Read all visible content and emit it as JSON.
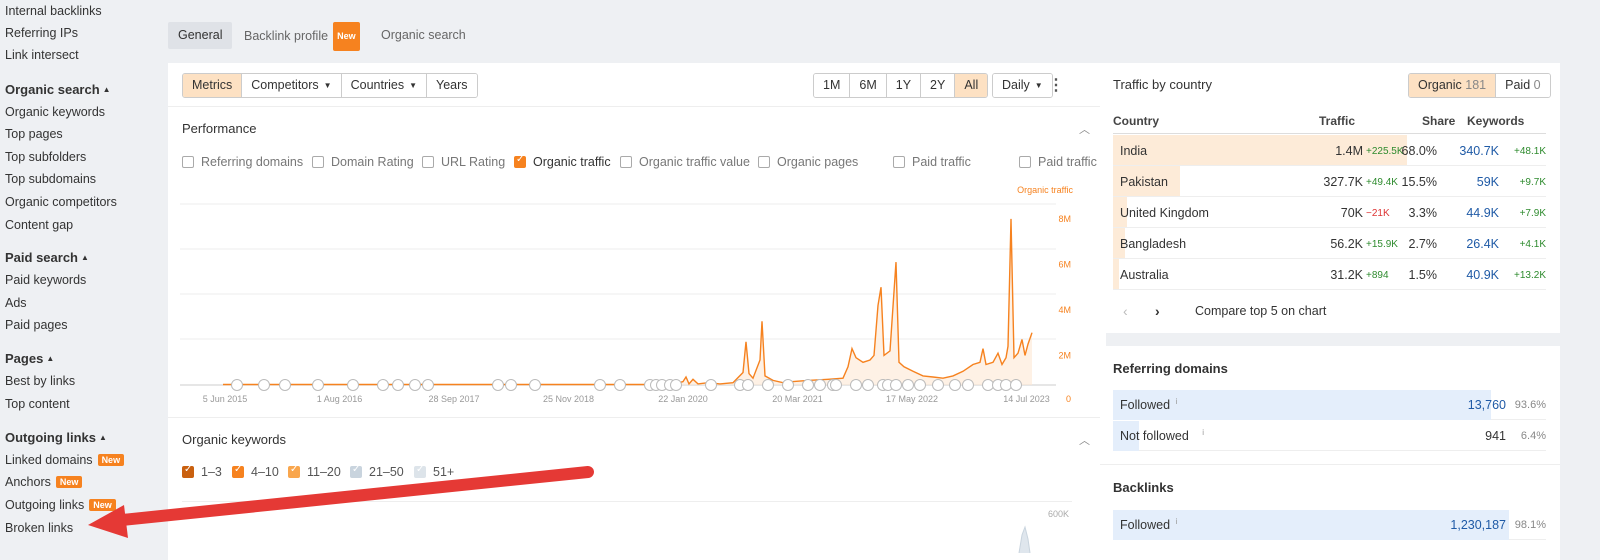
{
  "sidebar": {
    "backlinks_items": [
      "Internal backlinks",
      "Referring IPs",
      "Link intersect"
    ],
    "organic_search": {
      "title": "Organic search",
      "items": [
        "Organic keywords",
        "Top pages",
        "Top subfolders",
        "Top subdomains",
        "Organic competitors",
        "Content gap"
      ]
    },
    "paid_search": {
      "title": "Paid search",
      "items": [
        "Paid keywords",
        "Ads",
        "Paid pages"
      ]
    },
    "pages": {
      "title": "Pages",
      "items": [
        "Best by links",
        "Top content"
      ]
    },
    "outgoing_links": {
      "title": "Outgoing links",
      "items": [
        "Linked domains",
        "Anchors",
        "Outgoing links",
        "Broken links"
      ],
      "badge": "New"
    }
  },
  "tabs": {
    "general": "General",
    "backlink_profile": "Backlink profile",
    "badge": "New",
    "organic_search": "Organic search"
  },
  "toolbar": {
    "metrics": "Metrics",
    "competitors": "Competitors",
    "countries": "Countries",
    "years": "Years",
    "ranges": [
      "1M",
      "6M",
      "1Y",
      "2Y",
      "All"
    ],
    "selected_range": "All",
    "granularity": "Daily"
  },
  "performance": {
    "title": "Performance",
    "checkboxes": [
      {
        "label": "Referring domains",
        "checked": false
      },
      {
        "label": "Domain Rating",
        "checked": false
      },
      {
        "label": "URL Rating",
        "checked": false
      },
      {
        "label": "Organic traffic",
        "checked": true
      },
      {
        "label": "Organic traffic value",
        "checked": false
      },
      {
        "label": "Organic pages",
        "checked": false
      },
      {
        "label": "Paid traffic",
        "checked": false
      },
      {
        "label": "Paid traffic cost",
        "checked": false
      }
    ],
    "series_label": "Organic traffic",
    "y_ticks": [
      "8M",
      "6M",
      "4M",
      "2M",
      "0"
    ],
    "x_ticks": [
      "5 Jun 2015",
      "1 Aug 2016",
      "28 Sep 2017",
      "25 Nov 2018",
      "22 Jan 2020",
      "20 Mar 2021",
      "17 May 2022",
      "14 Jul 2023"
    ],
    "series_color": "#f6821f"
  },
  "chart_data": {
    "type": "line",
    "series": [
      {
        "name": "Organic traffic",
        "x": [
          "2015-06",
          "2016-06",
          "2017-06",
          "2018-06",
          "2019-06",
          "2019-12",
          "2020-03",
          "2020-06",
          "2020-09",
          "2020-12",
          "2021-03",
          "2021-06",
          "2021-09",
          "2021-12",
          "2022-03",
          "2022-06",
          "2022-09",
          "2022-12",
          "2023-03",
          "2023-07"
        ],
        "values": [
          0,
          0,
          0,
          0,
          0,
          0.05,
          0.3,
          0.1,
          1.2,
          0.9,
          0.3,
          0.2,
          0.5,
          1.5,
          0.6,
          0.3,
          0.4,
          0.8,
          1.2,
          1.9
        ]
      }
    ],
    "y_ticks": [
      "0",
      "2M",
      "4M",
      "6M",
      "8M"
    ],
    "ylim": [
      0,
      8
    ]
  },
  "organic_keywords": {
    "title": "Organic keywords",
    "ranges": [
      "1–3",
      "4–10",
      "11–20",
      "21–50",
      "51+"
    ],
    "y_tick": "600K"
  },
  "traffic_by_country": {
    "title": "Traffic by country",
    "organic_label": "Organic",
    "organic_count": "181",
    "paid_label": "Paid",
    "paid_count": "0",
    "headers": [
      "Country",
      "Traffic",
      "Share",
      "Keywords"
    ],
    "rows": [
      {
        "country": "India",
        "traffic": "1.4M",
        "traffic_delta": "+225.5K",
        "share": "68.0%",
        "keywords": "340.7K",
        "kw_delta": "+48.1K",
        "share_frac": 0.68
      },
      {
        "country": "Pakistan",
        "traffic": "327.7K",
        "traffic_delta": "+49.4K",
        "share": "15.5%",
        "keywords": "59K",
        "kw_delta": "+9.7K",
        "share_frac": 0.155
      },
      {
        "country": "United Kingdom",
        "traffic": "70K",
        "traffic_delta": "−21K",
        "share": "3.3%",
        "keywords": "44.9K",
        "kw_delta": "+7.9K",
        "share_frac": 0.033
      },
      {
        "country": "Bangladesh",
        "traffic": "56.2K",
        "traffic_delta": "+15.9K",
        "share": "2.7%",
        "keywords": "26.4K",
        "kw_delta": "+4.1K",
        "share_frac": 0.027
      },
      {
        "country": "Australia",
        "traffic": "31.2K",
        "traffic_delta": "+894",
        "share": "1.5%",
        "keywords": "40.9K",
        "kw_delta": "+13.2K",
        "share_frac": 0.015
      }
    ],
    "compare_label": "Compare top 5 on chart"
  },
  "referring_domains": {
    "title": "Referring domains",
    "rows": [
      {
        "label": "Followed",
        "value": "13,760",
        "pct": "93.6%",
        "frac": 0.936
      },
      {
        "label": "Not followed",
        "value": "941",
        "pct": "6.4%",
        "frac": 0.064
      }
    ]
  },
  "backlinks": {
    "title": "Backlinks",
    "rows": [
      {
        "label": "Followed",
        "value": "1,230,187",
        "pct": "98.1%",
        "frac": 0.981
      }
    ]
  },
  "annotation_arrow_color": "#e53935"
}
